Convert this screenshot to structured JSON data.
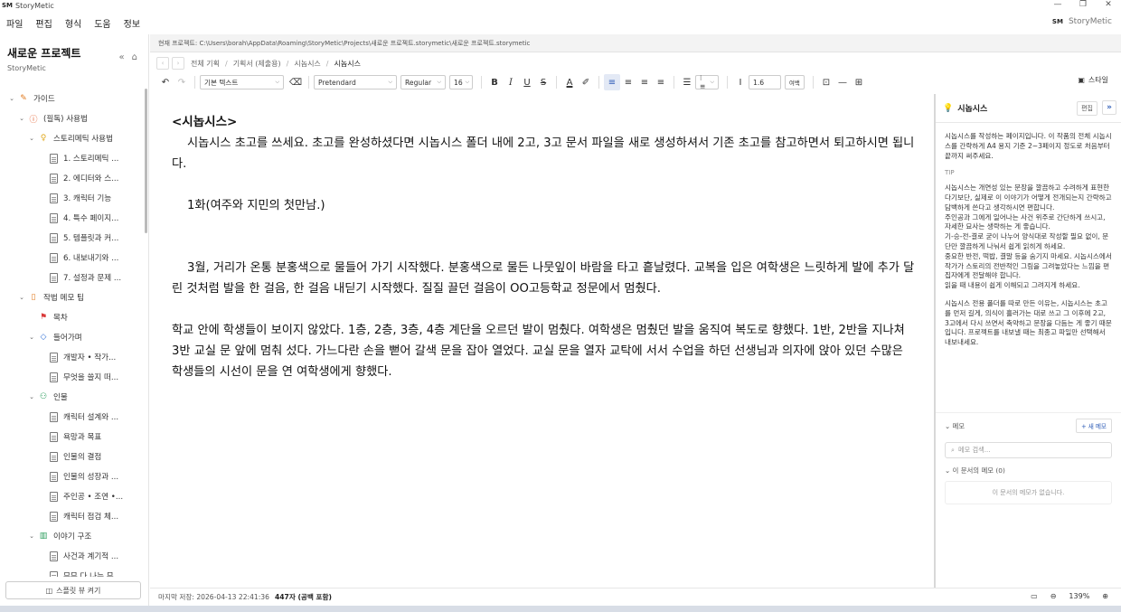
{
  "window": {
    "logo": "SM",
    "title": "StoryMetic",
    "controls": [
      "—",
      "❐",
      "✕"
    ]
  },
  "menu": {
    "items": [
      "파일",
      "편집",
      "형식",
      "도움",
      "정보"
    ],
    "brand_logo": "SM",
    "brand": "StoryMetic"
  },
  "sidebar": {
    "project_title": "새로운 프로젝트",
    "project_sub": "StoryMetic",
    "tree": [
      {
        "label": "가이드",
        "level": 0,
        "chev": "⌄",
        "icon": "pencil-icon",
        "glyph": "✎",
        "color": "#e07a1f"
      },
      {
        "label": "(필독) 사용법",
        "level": 1,
        "chev": "⌄",
        "icon": "alert-circle-icon",
        "glyph": "ⓘ",
        "color": "#e0531f"
      },
      {
        "label": "스토리메틱 사용법",
        "level": 2,
        "chev": "⌄",
        "icon": "lightbulb-icon",
        "glyph": "♀",
        "color": "#e0a91f"
      },
      {
        "label": "1. 스토리메틱 ...",
        "level": 3,
        "icon": "document-icon"
      },
      {
        "label": "2. 에디터와 스...",
        "level": 3,
        "icon": "document-icon"
      },
      {
        "label": "3. 캐릭터 기능",
        "level": 3,
        "icon": "document-icon"
      },
      {
        "label": "4. 특수 페이지...",
        "level": 3,
        "icon": "document-icon"
      },
      {
        "label": "5. 템플릿과 커...",
        "level": 3,
        "icon": "document-icon"
      },
      {
        "label": "6. 내보내기와 ...",
        "level": 3,
        "icon": "document-icon"
      },
      {
        "label": "7. 설정과 문제 ...",
        "level": 3,
        "icon": "document-icon"
      },
      {
        "label": "작법 메모 팁",
        "level": 1,
        "chev": "⌄",
        "icon": "notebook-icon",
        "glyph": "▯",
        "color": "#e07a1f"
      },
      {
        "label": "목차",
        "level": 2,
        "icon": "bookmark-icon",
        "glyph": "⚑",
        "color": "#d93a3a"
      },
      {
        "label": "들어가며",
        "level": 2,
        "chev": "⌄",
        "icon": "tag-icon",
        "glyph": "◇",
        "color": "#2f6fd6"
      },
      {
        "label": "개발자 • 작가...",
        "level": 3,
        "icon": "document-icon"
      },
      {
        "label": "무엇을 쓸지 떠...",
        "level": 3,
        "icon": "document-icon"
      },
      {
        "label": "인물",
        "level": 2,
        "chev": "⌄",
        "icon": "user-check-icon",
        "glyph": "⚇",
        "color": "#2a9d5c"
      },
      {
        "label": "캐릭터 설계와 ...",
        "level": 3,
        "icon": "document-icon"
      },
      {
        "label": "욕망과 목표",
        "level": 3,
        "icon": "document-icon"
      },
      {
        "label": "인물의 결점",
        "level": 3,
        "icon": "document-icon"
      },
      {
        "label": "인물의 성장과 ...",
        "level": 3,
        "icon": "document-icon"
      },
      {
        "label": "주인공 • 조연 •...",
        "level": 3,
        "icon": "document-icon"
      },
      {
        "label": "캐릭터 점검 체...",
        "level": 3,
        "icon": "document-icon"
      },
      {
        "label": "이야기 구조",
        "level": 2,
        "chev": "⌄",
        "icon": "map-icon",
        "glyph": "▥",
        "color": "#2a9d5c"
      },
      {
        "label": "사건과 계기적 ...",
        "level": 3,
        "icon": "document-icon"
      },
      {
        "label": "무무 다 나는 무...",
        "level": 3,
        "icon": "document-icon"
      }
    ],
    "footer_label": "스플릿 뷰 켜기"
  },
  "pathbar": {
    "text": "현재 프로젝트: C:\\Users\\borah\\AppData\\Roaming\\StoryMetic\\Projects\\새로운 프로젝트.storymetic\\새로운 프로젝트.storymetic"
  },
  "breadcrumbs": {
    "items": [
      "전체 기획",
      "기획서 (제출용)",
      "시놉시스",
      "시놉시스"
    ]
  },
  "toolbar": {
    "style": "기본 텍스트",
    "font": "Pretendard",
    "weight": "Regular",
    "size": "16",
    "line_height": "1.6",
    "spacing_label": "여백",
    "style_panel": "스타일"
  },
  "document": {
    "heading": "<시놉시스>",
    "paragraphs": [
      "시놉시스 초고를 쓰세요. 초고를 완성하셨다면 시놉시스 폴더 내에 2고, 3고 문서 파일을 새로 생성하셔서 기존 초고를 참고하면서 퇴고하시면 됩니다.",
      "",
      "1화(여주와 지민의 첫만남.)",
      "",
      "",
      "3월, 거리가 온통 분홍색으로 물들어 가기 시작했다. 분홍색으로 물든 나뭇잎이 바람을 타고 흩날렸다. 교복을 입은 여학생은 느릿하게 발에 추가 달린 것처럼 발을 한 걸음, 한 걸음 내딛기 시작했다. 질질 끌던 걸음이 OO고등학교 정문에서 멈췄다.",
      "",
      "학교 안에 학생들이 보이지 않았다. 1층, 2층, 3층, 4층 계단을 오르던 발이 멈췄다. 여학생은 멈췄던 발을 움직여 복도로 향했다. 1반, 2반을 지나쳐 3반 교실 문 앞에 멈춰 섰다. 가느다란 손을 뻗어 갈색 문을 잡아 열었다. 교실 문을 열자 교탁에 서서 수업을 하던 선생님과 의자에 앉아 있던 수많은 학생들의 시선이 문을 연 여학생에게 향했다."
    ]
  },
  "panel": {
    "title": "시놉시스",
    "edit_label": "편집",
    "more": "»",
    "description": "시놉시스를 작성하는 페이지입니다. 이 작품의 전체 시놉시스를 간략하게 A4 용지 기준 2~3페이지 정도로 처음부터 끝까지 써주세요.",
    "tip_label": "TIP",
    "tips": [
      "시놉시스는 개연성 있는 문장을 깔끔하고 수려하게 표현한다기보단, 실제로 이 이야기가 어떻게 전개되는지 간략하고 담백하게 쓴다고 생각하시면 편합니다.",
      "주인공과 그에게 일어나는 사건 위주로 간단하게 쓰시고, 자세한 묘사는 생략하는 게 좋습니다.",
      "기-승-전-결로 굳이 나누어 양식대로 작성할 필요 없이, 문단만 깔끔하게 나눠서 쉽게 읽히게 하세요.",
      "중요한 반전, 떡밥, 결말 등을 숨기지 마세요. 시놉시스에서 작가가 스토리의 전반적인 그림을 그려놓았다는 느낌을 편집자에게 전달해야 합니다.",
      "읽을 때 내용이 쉽게 이해되고 그려지게 하세요.",
      "",
      "시놉시스 전용 폴더를 따로 만든 이유는, 시놉시스는 초고를 먼저 길게, 의식이 흘러가는 대로 쓰고 그 이후에 2고, 3고에서 다시 쓰면서 축약하고 문장을 다듬는 게 좋기 때문입니다. 프로젝트를 내보낼 때는 최종고 파일만 선택해서 내보내세요."
    ],
    "memo_label": "메모",
    "new_memo": "+ 새 메모",
    "memo_search_placeholder": "메모 검색...",
    "doc_memo_label": "이 문서의 메모 (0)",
    "memo_empty": "이 문서의 메모가 없습니다."
  },
  "status": {
    "saved": "마지막 저장: 2026-04-13 22:41:36",
    "count": "447자 (공백 포함)",
    "zoom": "139%"
  }
}
